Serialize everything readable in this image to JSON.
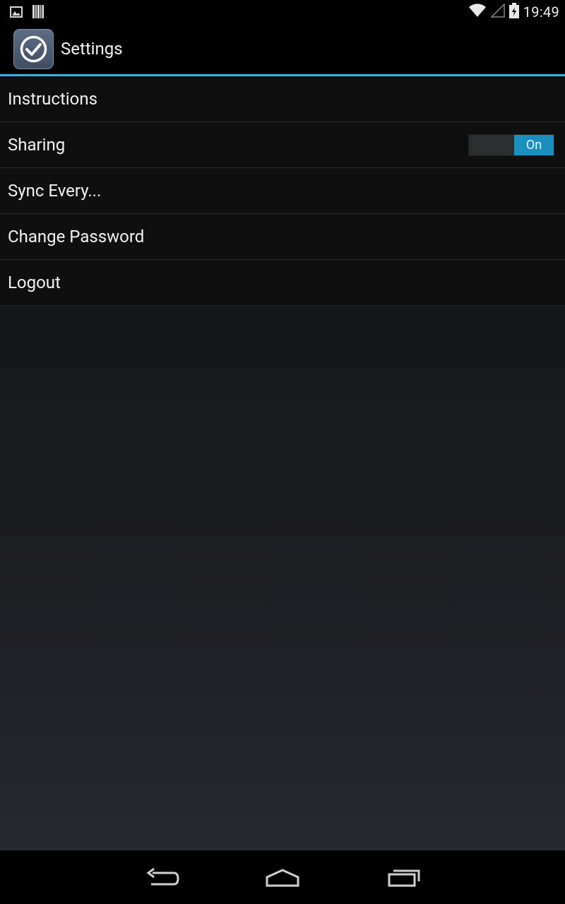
{
  "status_bar": {
    "time": "19:49",
    "icons": [
      "image-notification-icon",
      "barcode-notification-icon",
      "wifi-icon",
      "signal-icon",
      "battery-charging-icon"
    ]
  },
  "action_bar": {
    "title": "Settings",
    "app_icon": "checkmark-app-icon"
  },
  "settings": {
    "items": [
      {
        "label": "Instructions"
      },
      {
        "label": "Sharing",
        "toggle": "On"
      },
      {
        "label": "Sync Every..."
      },
      {
        "label": "Change Password"
      },
      {
        "label": "Logout"
      }
    ]
  },
  "nav_bar": {
    "buttons": [
      "back-icon",
      "home-icon",
      "recent-apps-icon"
    ]
  },
  "colors": {
    "accent": "#33b5e5",
    "toggle_on": "#1a8fc0"
  }
}
